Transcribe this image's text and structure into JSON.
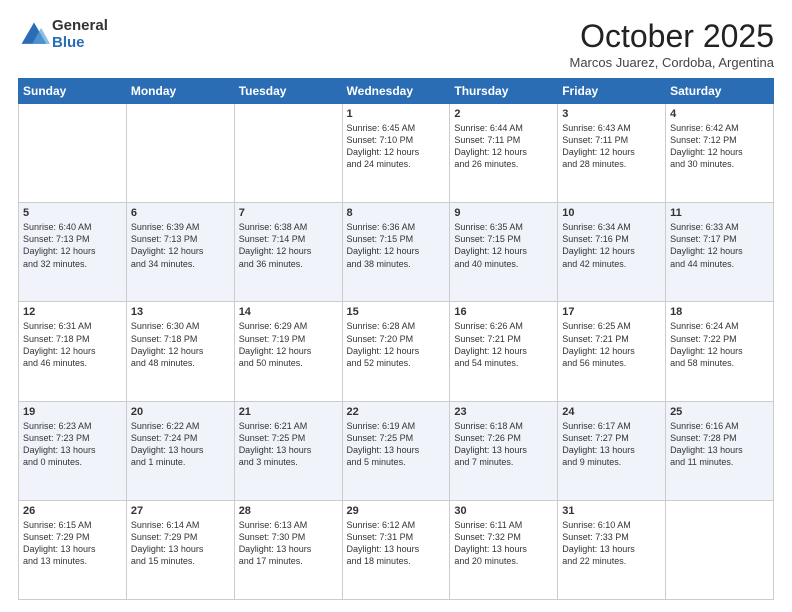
{
  "logo": {
    "general": "General",
    "blue": "Blue"
  },
  "header": {
    "month": "October 2025",
    "location": "Marcos Juarez, Cordoba, Argentina"
  },
  "weekdays": [
    "Sunday",
    "Monday",
    "Tuesday",
    "Wednesday",
    "Thursday",
    "Friday",
    "Saturday"
  ],
  "weeks": [
    [
      {
        "day": "",
        "info": ""
      },
      {
        "day": "",
        "info": ""
      },
      {
        "day": "",
        "info": ""
      },
      {
        "day": "1",
        "info": "Sunrise: 6:45 AM\nSunset: 7:10 PM\nDaylight: 12 hours\nand 24 minutes."
      },
      {
        "day": "2",
        "info": "Sunrise: 6:44 AM\nSunset: 7:11 PM\nDaylight: 12 hours\nand 26 minutes."
      },
      {
        "day": "3",
        "info": "Sunrise: 6:43 AM\nSunset: 7:11 PM\nDaylight: 12 hours\nand 28 minutes."
      },
      {
        "day": "4",
        "info": "Sunrise: 6:42 AM\nSunset: 7:12 PM\nDaylight: 12 hours\nand 30 minutes."
      }
    ],
    [
      {
        "day": "5",
        "info": "Sunrise: 6:40 AM\nSunset: 7:13 PM\nDaylight: 12 hours\nand 32 minutes."
      },
      {
        "day": "6",
        "info": "Sunrise: 6:39 AM\nSunset: 7:13 PM\nDaylight: 12 hours\nand 34 minutes."
      },
      {
        "day": "7",
        "info": "Sunrise: 6:38 AM\nSunset: 7:14 PM\nDaylight: 12 hours\nand 36 minutes."
      },
      {
        "day": "8",
        "info": "Sunrise: 6:36 AM\nSunset: 7:15 PM\nDaylight: 12 hours\nand 38 minutes."
      },
      {
        "day": "9",
        "info": "Sunrise: 6:35 AM\nSunset: 7:15 PM\nDaylight: 12 hours\nand 40 minutes."
      },
      {
        "day": "10",
        "info": "Sunrise: 6:34 AM\nSunset: 7:16 PM\nDaylight: 12 hours\nand 42 minutes."
      },
      {
        "day": "11",
        "info": "Sunrise: 6:33 AM\nSunset: 7:17 PM\nDaylight: 12 hours\nand 44 minutes."
      }
    ],
    [
      {
        "day": "12",
        "info": "Sunrise: 6:31 AM\nSunset: 7:18 PM\nDaylight: 12 hours\nand 46 minutes."
      },
      {
        "day": "13",
        "info": "Sunrise: 6:30 AM\nSunset: 7:18 PM\nDaylight: 12 hours\nand 48 minutes."
      },
      {
        "day": "14",
        "info": "Sunrise: 6:29 AM\nSunset: 7:19 PM\nDaylight: 12 hours\nand 50 minutes."
      },
      {
        "day": "15",
        "info": "Sunrise: 6:28 AM\nSunset: 7:20 PM\nDaylight: 12 hours\nand 52 minutes."
      },
      {
        "day": "16",
        "info": "Sunrise: 6:26 AM\nSunset: 7:21 PM\nDaylight: 12 hours\nand 54 minutes."
      },
      {
        "day": "17",
        "info": "Sunrise: 6:25 AM\nSunset: 7:21 PM\nDaylight: 12 hours\nand 56 minutes."
      },
      {
        "day": "18",
        "info": "Sunrise: 6:24 AM\nSunset: 7:22 PM\nDaylight: 12 hours\nand 58 minutes."
      }
    ],
    [
      {
        "day": "19",
        "info": "Sunrise: 6:23 AM\nSunset: 7:23 PM\nDaylight: 13 hours\nand 0 minutes."
      },
      {
        "day": "20",
        "info": "Sunrise: 6:22 AM\nSunset: 7:24 PM\nDaylight: 13 hours\nand 1 minute."
      },
      {
        "day": "21",
        "info": "Sunrise: 6:21 AM\nSunset: 7:25 PM\nDaylight: 13 hours\nand 3 minutes."
      },
      {
        "day": "22",
        "info": "Sunrise: 6:19 AM\nSunset: 7:25 PM\nDaylight: 13 hours\nand 5 minutes."
      },
      {
        "day": "23",
        "info": "Sunrise: 6:18 AM\nSunset: 7:26 PM\nDaylight: 13 hours\nand 7 minutes."
      },
      {
        "day": "24",
        "info": "Sunrise: 6:17 AM\nSunset: 7:27 PM\nDaylight: 13 hours\nand 9 minutes."
      },
      {
        "day": "25",
        "info": "Sunrise: 6:16 AM\nSunset: 7:28 PM\nDaylight: 13 hours\nand 11 minutes."
      }
    ],
    [
      {
        "day": "26",
        "info": "Sunrise: 6:15 AM\nSunset: 7:29 PM\nDaylight: 13 hours\nand 13 minutes."
      },
      {
        "day": "27",
        "info": "Sunrise: 6:14 AM\nSunset: 7:29 PM\nDaylight: 13 hours\nand 15 minutes."
      },
      {
        "day": "28",
        "info": "Sunrise: 6:13 AM\nSunset: 7:30 PM\nDaylight: 13 hours\nand 17 minutes."
      },
      {
        "day": "29",
        "info": "Sunrise: 6:12 AM\nSunset: 7:31 PM\nDaylight: 13 hours\nand 18 minutes."
      },
      {
        "day": "30",
        "info": "Sunrise: 6:11 AM\nSunset: 7:32 PM\nDaylight: 13 hours\nand 20 minutes."
      },
      {
        "day": "31",
        "info": "Sunrise: 6:10 AM\nSunset: 7:33 PM\nDaylight: 13 hours\nand 22 minutes."
      },
      {
        "day": "",
        "info": ""
      }
    ]
  ]
}
